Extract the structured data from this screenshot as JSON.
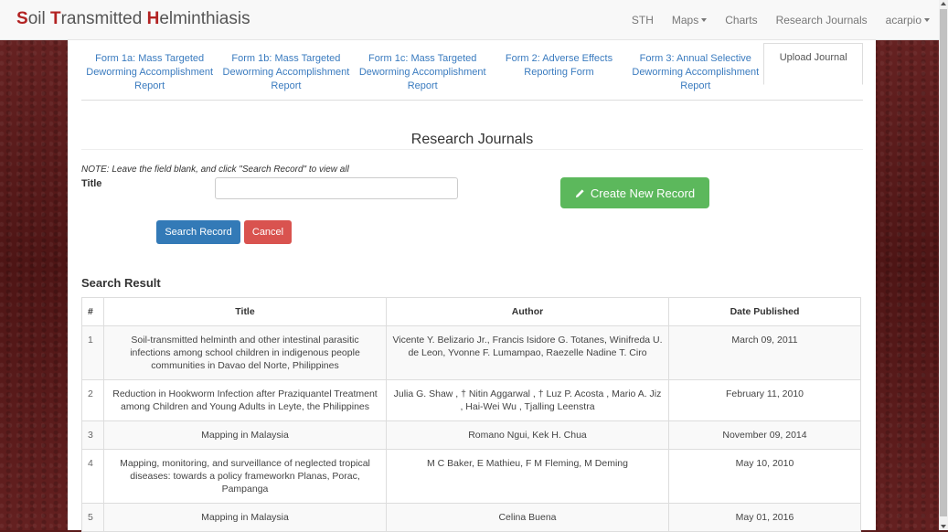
{
  "brand": {
    "s": "S",
    "oil": "oil ",
    "t": "T",
    "ransmitted": "ransmitted ",
    "h": "H",
    "elminthiasis": "elminthiasis"
  },
  "nav": {
    "sth": "STH",
    "maps": "Maps",
    "charts": "Charts",
    "research": "Research Journals",
    "user": "acarpio"
  },
  "tabs": [
    {
      "label": "Form 1a: Mass Targeted Deworming Accomplishment Report"
    },
    {
      "label": "Form 1b: Mass Targeted Deworming Accomplishment Report"
    },
    {
      "label": "Form 1c: Mass Targeted Deworming Accomplishment Report"
    },
    {
      "label": "Form 2: Adverse Effects Reporting Form"
    },
    {
      "label": "Form 3: Annual Selective Deworming Accomplishment Report"
    },
    {
      "label": "Upload Journal"
    }
  ],
  "page_title": "Research Journals",
  "form": {
    "note": "NOTE: Leave the field blank, and click \"Search Record\" to view all",
    "title_label": "Title",
    "title_value": "",
    "create_label": "Create New Record",
    "search_label": "Search Record",
    "cancel_label": "Cancel"
  },
  "results": {
    "heading": "Search Result",
    "columns": {
      "idx": "#",
      "title": "Title",
      "author": "Author",
      "date": "Date Published"
    },
    "rows": [
      {
        "idx": "1",
        "title": "Soil-transmitted helminth and other intestinal parasitic infections among school children in indigenous people communities in Davao del Norte, Philippines",
        "author": "Vicente Y. Belizario Jr., Francis Isidore G. Totanes, Winifreda U. de Leon, Yvonne F. Lumampao, Raezelle Nadine T. Ciro",
        "date": "March 09, 2011"
      },
      {
        "idx": "2",
        "title": "Reduction in Hookworm Infection after Praziquantel Treatment among Children and Young Adults in Leyte, the Philippines",
        "author": "Julia G. Shaw , † Nitin Aggarwal , † Luz P. Acosta , Mario A. Jiz , Hai-Wei Wu , Tjalling Leenstra",
        "date": "February 11, 2010"
      },
      {
        "idx": "3",
        "title": "Mapping in Malaysia",
        "author": "Romano Ngui, Kek H. Chua",
        "date": "November 09, 2014"
      },
      {
        "idx": "4",
        "title": "Mapping, monitoring, and surveillance of neglected tropical diseases: towards a policy frameworkn Planas, Porac, Pampanga",
        "author": "M C Baker, E Mathieu, F M Fleming, M Deming",
        "date": "May 10, 2010"
      },
      {
        "idx": "5",
        "title": "Mapping in Malaysia",
        "author": "Celina Buena",
        "date": "May 01, 2016"
      }
    ]
  }
}
